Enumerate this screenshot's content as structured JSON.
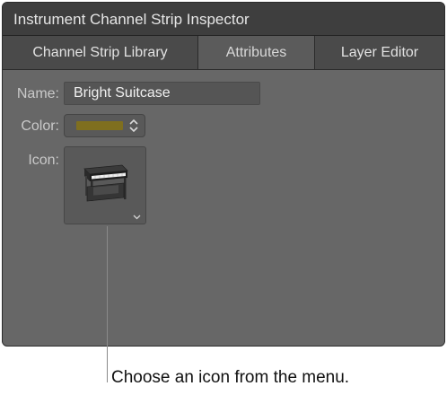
{
  "window": {
    "title": "Instrument Channel Strip Inspector"
  },
  "tabs": [
    {
      "label": "Channel Strip Library",
      "active": false
    },
    {
      "label": "Attributes",
      "active": true
    },
    {
      "label": "Layer Editor",
      "active": false
    }
  ],
  "attributes": {
    "name_label": "Name:",
    "name_value": "Bright Suitcase",
    "color_label": "Color:",
    "color_value": "#7f6f1f",
    "icon_label": "Icon:",
    "icon_value": "electric-piano-icon"
  },
  "callout": {
    "text": "Choose an icon from the menu."
  },
  "colors": {
    "panel_bg": "#676767",
    "titlebar_bg": "#3e3e3e",
    "tab_bg": "#4a4a4a",
    "tab_active_bg": "#5b5b5b"
  }
}
